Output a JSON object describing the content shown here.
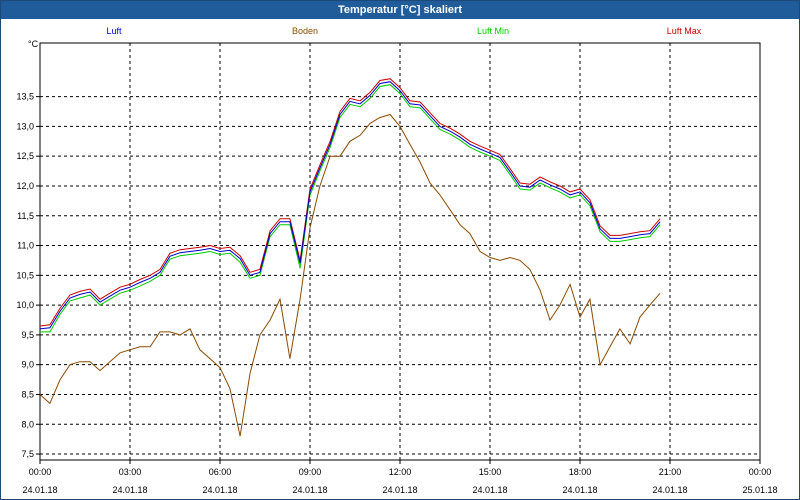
{
  "window": {
    "title": "Temperatur [°C] skaliert"
  },
  "chart_data": {
    "type": "line",
    "title": "Temperatur [°C] skaliert",
    "ylabel": "°C",
    "ylim": [
      7.4,
      14.4
    ],
    "xlim": [
      0,
      24
    ],
    "grid": true,
    "legend_position": "top",
    "y_ticks": [
      "7,5",
      "8,0",
      "8,5",
      "9,0",
      "9,5",
      "10,0",
      "10,5",
      "11,0",
      "11,5",
      "12,0",
      "12,5",
      "13,0",
      "13,5"
    ],
    "y_tick_values": [
      7.5,
      8.0,
      8.5,
      9.0,
      9.5,
      10.0,
      10.5,
      11.0,
      11.5,
      12.0,
      12.5,
      13.0,
      13.5
    ],
    "x_ticks": [
      {
        "time": "00:00",
        "date": "24.01.18"
      },
      {
        "time": "03:00",
        "date": "24.01.18"
      },
      {
        "time": "06:00",
        "date": "24.01.18"
      },
      {
        "time": "09:00",
        "date": "24.01.18"
      },
      {
        "time": "12:00",
        "date": "24.01.18"
      },
      {
        "time": "15:00",
        "date": "24.01.18"
      },
      {
        "time": "18:00",
        "date": "24.01.18"
      },
      {
        "time": "21:00",
        "date": "24.01.18"
      },
      {
        "time": "00:00",
        "date": "25.01.18"
      }
    ],
    "x_tick_values": [
      0,
      3,
      6,
      9,
      12,
      15,
      18,
      21,
      24
    ],
    "x": [
      0,
      0.33,
      0.67,
      1,
      1.33,
      1.67,
      2,
      2.33,
      2.67,
      3,
      3.33,
      3.67,
      4,
      4.33,
      4.67,
      5,
      5.33,
      5.67,
      6,
      6.33,
      6.67,
      7,
      7.33,
      7.67,
      8,
      8.33,
      8.67,
      9,
      9.33,
      9.67,
      10,
      10.33,
      10.67,
      11,
      11.33,
      11.67,
      12,
      12.33,
      12.67,
      13,
      13.33,
      13.67,
      14,
      14.33,
      14.67,
      15,
      15.33,
      15.67,
      16,
      16.33,
      16.67,
      17,
      17.33,
      17.67,
      18,
      18.33,
      18.67,
      19,
      19.33,
      19.67,
      20,
      20.33,
      20.67,
      21,
      21.33,
      21.67,
      22,
      22.33,
      22.67,
      23,
      23.33,
      23.67,
      24
    ],
    "series": [
      {
        "name": "Luft",
        "color": "#0000cc",
        "values": [
          9.6,
          9.62,
          9.9,
          10.12,
          10.18,
          10.22,
          10.05,
          10.15,
          10.25,
          10.3,
          10.38,
          10.45,
          10.55,
          10.82,
          10.88,
          10.9,
          10.92,
          10.95,
          10.9,
          10.92,
          10.78,
          10.5,
          10.55,
          11.2,
          11.4,
          11.4,
          10.7,
          11.9,
          12.3,
          12.7,
          13.2,
          13.42,
          13.38,
          13.52,
          13.72,
          13.75,
          13.6,
          13.38,
          13.36,
          13.18,
          13.0,
          12.92,
          12.82,
          12.7,
          12.62,
          12.55,
          12.48,
          12.24,
          12.0,
          11.98,
          12.1,
          12.02,
          11.95,
          11.85,
          11.9,
          11.72,
          11.28,
          11.12,
          11.12,
          11.15,
          11.18,
          11.2,
          11.4
        ]
      },
      {
        "name": "Boden",
        "color": "#8b4a00",
        "values": [
          8.5,
          8.35,
          8.75,
          9.0,
          9.05,
          9.05,
          8.9,
          9.05,
          9.2,
          9.25,
          9.3,
          9.3,
          9.55,
          9.55,
          9.5,
          9.6,
          9.25,
          9.1,
          8.95,
          8.6,
          7.8,
          8.85,
          9.5,
          9.75,
          10.1,
          9.1,
          10.1,
          11.3,
          12.0,
          12.5,
          12.5,
          12.75,
          12.85,
          13.05,
          13.15,
          13.2,
          13.0,
          12.7,
          12.4,
          12.05,
          11.85,
          11.6,
          11.35,
          11.2,
          10.9,
          10.8,
          10.75,
          10.8,
          10.75,
          10.6,
          10.25,
          9.75,
          10.0,
          10.35,
          9.8,
          10.1,
          9.0,
          9.3,
          9.6,
          9.35,
          9.8,
          10.0,
          10.2
        ]
      },
      {
        "name": "Luft Min",
        "color": "#00cc00",
        "values": [
          9.55,
          9.55,
          9.85,
          10.07,
          10.12,
          10.17,
          10.0,
          10.1,
          10.2,
          10.25,
          10.32,
          10.4,
          10.5,
          10.77,
          10.83,
          10.85,
          10.87,
          10.9,
          10.85,
          10.87,
          10.72,
          10.45,
          10.5,
          11.15,
          11.35,
          11.35,
          10.62,
          11.85,
          12.25,
          12.65,
          13.15,
          13.37,
          13.33,
          13.47,
          13.67,
          13.7,
          13.55,
          13.33,
          13.31,
          13.13,
          12.95,
          12.87,
          12.77,
          12.65,
          12.57,
          12.5,
          12.43,
          12.19,
          11.95,
          11.93,
          12.05,
          11.97,
          11.9,
          11.8,
          11.85,
          11.67,
          11.23,
          11.07,
          11.07,
          11.1,
          11.13,
          11.15,
          11.35
        ]
      },
      {
        "name": "Luft Max",
        "color": "#cc0000",
        "values": [
          9.65,
          9.67,
          9.95,
          10.17,
          10.23,
          10.27,
          10.1,
          10.2,
          10.3,
          10.35,
          10.43,
          10.5,
          10.6,
          10.87,
          10.93,
          10.95,
          10.97,
          11.0,
          10.95,
          10.97,
          10.83,
          10.55,
          10.6,
          11.25,
          11.45,
          11.45,
          10.75,
          11.95,
          12.35,
          12.75,
          13.25,
          13.47,
          13.43,
          13.57,
          13.77,
          13.8,
          13.65,
          13.43,
          13.41,
          13.23,
          13.05,
          12.97,
          12.87,
          12.75,
          12.67,
          12.6,
          12.53,
          12.29,
          12.05,
          12.03,
          12.15,
          12.07,
          12.0,
          11.9,
          11.95,
          11.77,
          11.33,
          11.17,
          11.17,
          11.2,
          11.23,
          11.25,
          11.45
        ]
      }
    ]
  }
}
